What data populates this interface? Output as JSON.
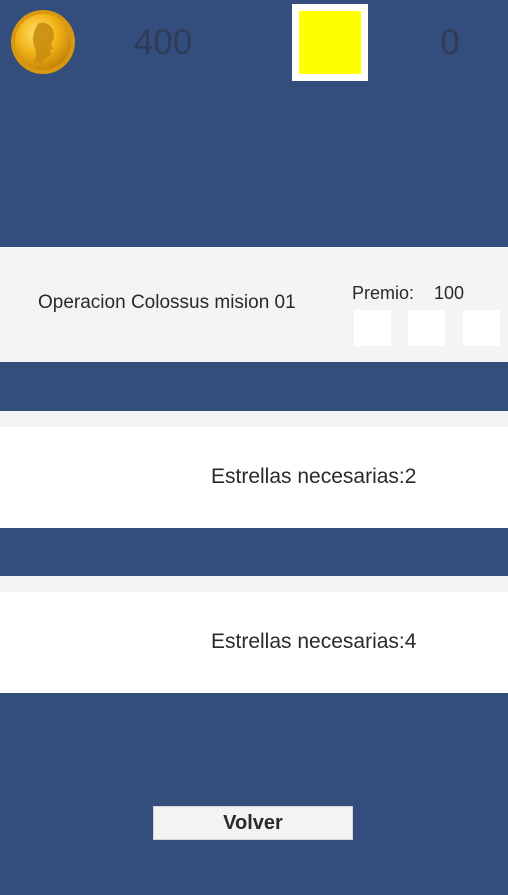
{
  "header": {
    "coins": "400",
    "stars": "0",
    "colors": {
      "background": "#334d7c",
      "coin_gold": "#f2b418",
      "star_fill": "#ffff00"
    }
  },
  "mission": {
    "title": "Operacion Colossus mision 01",
    "prize_label": "Premio:",
    "prize_value": "100",
    "stars_slots": 3
  },
  "locked_missions": [
    {
      "label": "Estrellas necesarias:2"
    },
    {
      "label": "Estrellas necesarias:4"
    }
  ],
  "footer": {
    "back_label": "Volver"
  },
  "icons": {
    "coin": "gold-coin-icon",
    "star": "star-box-icon"
  }
}
